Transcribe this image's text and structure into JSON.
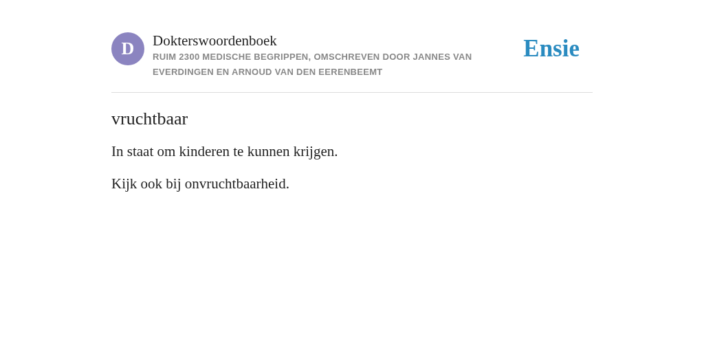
{
  "header": {
    "avatar_letter": "D",
    "title": "Dokterswoordenboek",
    "subtitle": "RUIM 2300 MEDISCHE BEGRIPPEN, OMSCHREVEN DOOR JANNES VAN EVERDINGEN EN ARNOUD VAN DEN EERENBEEMT",
    "logo": "Ensie"
  },
  "entry": {
    "term": "vruchtbaar",
    "paragraphs": [
      "In staat om kinderen te kunnen krijgen.",
      "Kijk ook bij onvruchtbaarheid."
    ]
  }
}
